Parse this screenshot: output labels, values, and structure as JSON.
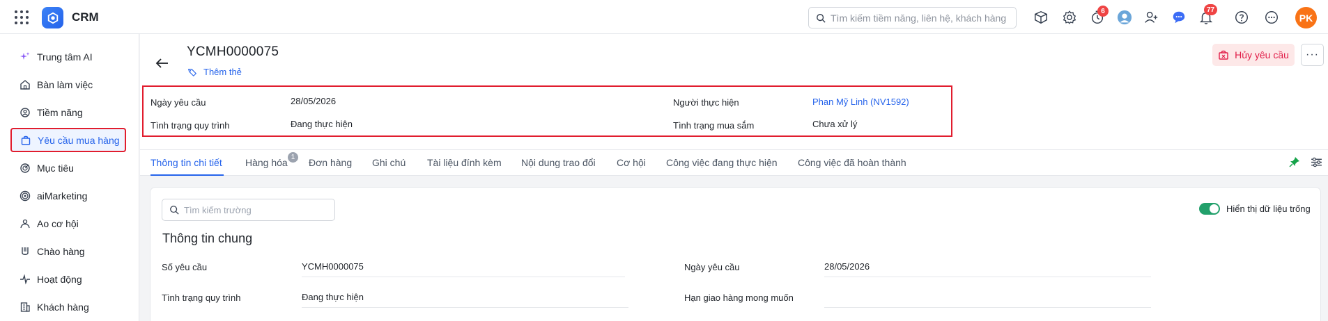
{
  "app": {
    "name": "CRM"
  },
  "topbar": {
    "search_placeholder": "Tìm kiếm tiềm năng, liên hệ, khách hàng",
    "timer_badge": "6",
    "notification_badge": "77",
    "user_initials": "PK"
  },
  "sidebar": {
    "items": [
      {
        "label": "Trung tâm AI",
        "icon": "sparkle-icon"
      },
      {
        "label": "Bàn làm việc",
        "icon": "home-icon"
      },
      {
        "label": "Tiềm năng",
        "icon": "lead-icon"
      },
      {
        "label": "Yêu cầu mua hàng",
        "icon": "shopping-bag-icon"
      },
      {
        "label": "Mục tiêu",
        "icon": "target-icon"
      },
      {
        "label": "aiMarketing",
        "icon": "marketing-icon"
      },
      {
        "label": "Ao cơ hội",
        "icon": "pond-icon"
      },
      {
        "label": "Chào hàng",
        "icon": "quote-icon"
      },
      {
        "label": "Hoạt động",
        "icon": "activity-icon"
      },
      {
        "label": "Khách hàng",
        "icon": "building-icon"
      }
    ]
  },
  "record": {
    "title": "YCMH0000075",
    "add_tag": "Thêm thẻ",
    "cancel_label": "Hủy yêu cầu",
    "more_label": "···"
  },
  "summary": {
    "request_date_label": "Ngày yêu cầu",
    "request_date": "28/05/2026",
    "process_status_label": "Tình trạng quy trình",
    "process_status": "Đang thực hiện",
    "assignee_label": "Người thực hiện",
    "assignee": "Phan Mỹ Linh (NV1592)",
    "purchase_status_label": "Tình trạng mua sắm",
    "purchase_status": "Chưa xử lý"
  },
  "tabs": [
    {
      "label": "Thông tin chi tiết",
      "active": true
    },
    {
      "label": "Hàng hóa",
      "badge": "1"
    },
    {
      "label": "Đơn hàng"
    },
    {
      "label": "Ghi chú"
    },
    {
      "label": "Tài liệu đính kèm"
    },
    {
      "label": "Nội dung trao đổi"
    },
    {
      "label": "Cơ hội"
    },
    {
      "label": "Công việc đang thực hiện"
    },
    {
      "label": "Công việc đã hoàn thành"
    }
  ],
  "detail": {
    "field_search_placeholder": "Tìm kiếm trường",
    "show_empty_label": "Hiển thị dữ liệu trống",
    "section_title": "Thông tin chung",
    "fields": {
      "request_no_label": "Số yêu cầu",
      "request_no": "YCMH0000075",
      "request_date_label": "Ngày yêu cầu",
      "request_date": "28/05/2026",
      "process_status_label": "Tình trạng quy trình",
      "process_status": "Đang thực hiện",
      "expected_delivery_label": "Hạn giao hàng mong muốn",
      "expected_delivery": ""
    }
  },
  "colors": {
    "accent": "#2563eb",
    "danger": "#e11d48",
    "highlight_border": "#e11d2e"
  }
}
